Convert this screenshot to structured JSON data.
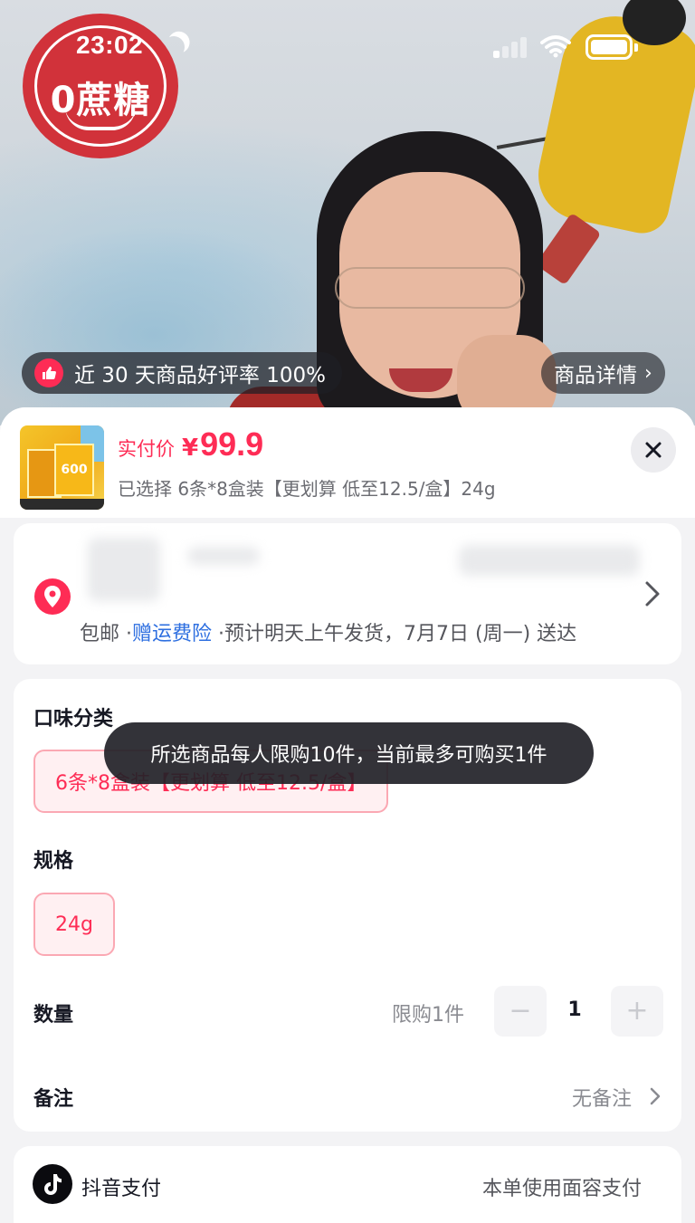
{
  "status_bar": {
    "time": "23:02"
  },
  "video": {
    "seal_text": "0蔗糖",
    "review_badge": "近 30 天商品好评率 100%",
    "details_button": "商品详情"
  },
  "product": {
    "price_label": "实付价",
    "currency": "¥",
    "price": "99.9",
    "thumb_text": "600",
    "selected_spec": "已选择 6条*8盒装【更划算 低至12.5/盒】24g"
  },
  "shipping": {
    "free_shipping": "包邮",
    "insurance": "赠运费险",
    "delivery": "预计明天上午发货，7月7日 (周一) 送达",
    "separator": "·"
  },
  "spec": {
    "flavor_title": "口味分类",
    "flavor_option": "6条*8盒装【更划算 低至12.5/盒】",
    "size_title": "规格",
    "size_option": "24g",
    "quantity_label": "数量",
    "quantity_limit": "限购1件",
    "quantity_value": "1",
    "note_label": "备注",
    "note_value": "无备注"
  },
  "payment": {
    "method": "抖音支付",
    "note": "本单使用面容支付"
  },
  "toast": {
    "message": "所选商品每人限购10件，当前最多可购买1件"
  },
  "colors": {
    "accent": "#fe2c55",
    "link": "#2e6fe0"
  }
}
